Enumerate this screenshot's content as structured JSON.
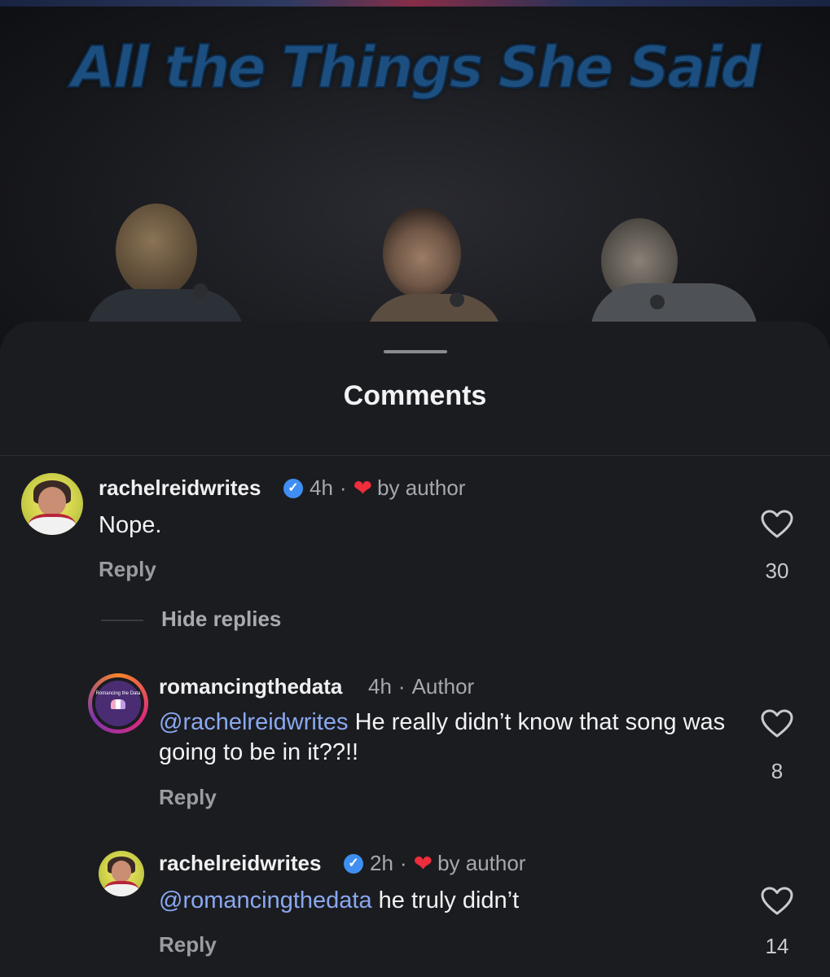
{
  "video": {
    "title": "All the Things She Said"
  },
  "sheet": {
    "title": "Comments"
  },
  "comments": [
    {
      "username": "rachelreidwrites",
      "verified": true,
      "time": "4h",
      "separator": "·",
      "liked_by_author": "by author",
      "text": "Nope.",
      "reply_label": "Reply",
      "likes": "30"
    },
    {
      "username": "romancingthedata",
      "verified": false,
      "time": "4h",
      "separator": "·",
      "author_badge": "Author",
      "mention": "@rachelreidwrites",
      "text": "He really didn’t know that song was going to be in it??!!",
      "reply_label": "Reply",
      "likes": "8",
      "avatar_text": "Romancing the Data"
    },
    {
      "username": "rachelreidwrites",
      "verified": true,
      "time": "2h",
      "separator": "·",
      "liked_by_author": "by author",
      "mention": "@romancingthedata",
      "text": "he truly didn’t",
      "reply_label": "Reply",
      "likes": "14"
    }
  ],
  "thread": {
    "hide_replies_label": "Hide replies"
  },
  "colors": {
    "background": "#1b1c20",
    "mention": "#8aa8f0",
    "verified": "#3f8ff2",
    "heart": "#ef2d3b"
  }
}
